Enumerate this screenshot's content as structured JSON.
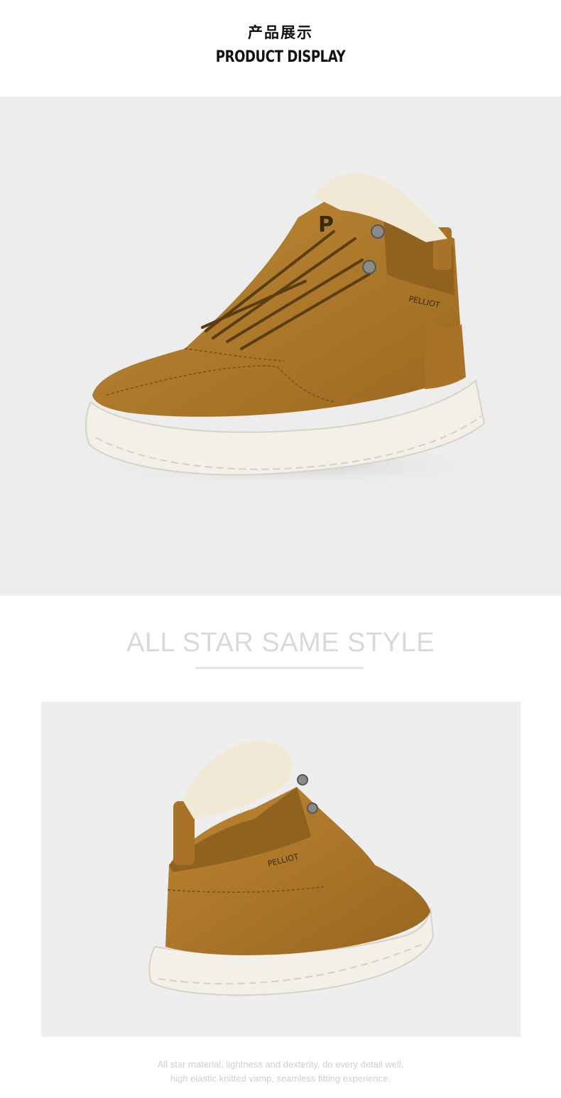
{
  "header": {
    "title_cn": "产品展示",
    "title_en": "PRODUCT DISPLAY"
  },
  "product": {
    "brand_mark": "PELLIOT",
    "tongue_logo": "P",
    "colors": {
      "suede": "#b07a2a",
      "suede_dark": "#8a5c1a",
      "sole": "#f3f0ea",
      "fur": "#f1e9d6",
      "panel_bg": "#ededed"
    }
  },
  "section": {
    "title": "ALL STAR SAME STYLE"
  },
  "caption": {
    "line1": "All star material, lightness and dexterity, do every detail well,",
    "line2": "high elastic knitted vamp, seamless fitting experience."
  }
}
